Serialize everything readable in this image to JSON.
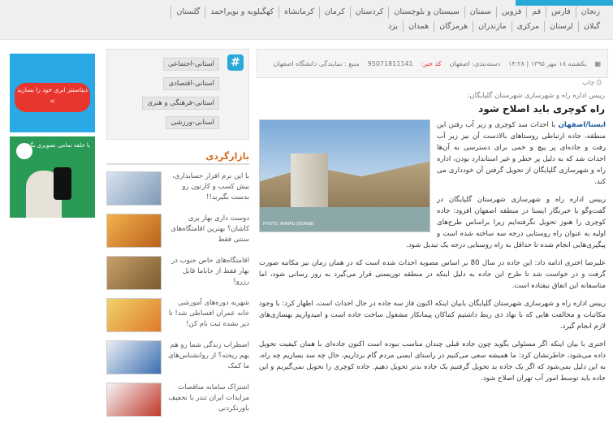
{
  "topbar": {
    "provinces": [
      "زنجان",
      "فارس",
      "قم",
      "قزوین",
      "سمنان",
      "سیستان و بلوچستان",
      "کردستان",
      "کرمان",
      "کرمانشاه",
      "کهگیلویه و بویراحمد",
      "گلستان",
      "گیلان",
      "لرستان",
      "مرکزی",
      "مازندران",
      "هرمزگان",
      "همدان",
      "یزد"
    ]
  },
  "article": {
    "meta": {
      "date": "یکشنبه ۱۸ مهر ۱۳۹۵ | ۱۴:۲۸",
      "category": "دسته‌بندی: اصفهان",
      "code_label": "کد خبر:",
      "code_value": "95071811141",
      "source": "منبع : نمایندگی دانشگاه اصفهان",
      "print": "چاپ"
    },
    "lead": "رییس اداره راه و شهرسازی شهرستان گلپایگان:",
    "title": "راه کوچری باید اصلاح شود",
    "brand": "ایسنا/اصفهان",
    "p1": "با احداث سد کوچری و زیر آب رفتن این منطقه، جاده ارتباطی روستاهای بالادست آن نیز زیر آب رفت و جاده‌ای پر پیچ و خمی برای دسترسی به آن‌ها احداث شد که به دلیل پر خطر و غیر استاندارد بودن، اداره راه و شهرسازی گلپایگان از تحویل گرفتن آن خودداری می کند.",
    "p2": "رییس اداره راه و شهرسازی شهرستان گلپایگان در گفت‌وگو با خبرنگار ایسنا در منطقه اصفهان افزود: جاده کوچری را هنوز تحویل نگرفته‌ایم زیرا براساس طرح‌های اولیه به عنوان راه روستایی درجه سه ساخته شده است و پیگیری‌هایی انجام شده تا حداقل به راه روستایی درجه یک تبدیل شود.",
    "p3": "علیرضا اختری ادامه داد: این جاده در سال 80 بر اساس مصوبه احداث شده است که در همان زمان نیز مکاتبه صورت گرفت و در خواست شد تا طرح این جاده به دلیل اینکه در منطقه توریستی قرار می‌گیرد به روز رسانی شود، اما متاسفانه این اتفاق نیفتاده است.",
    "p4": "رییس اداره راه و شهرسازی شهرستان گلپایگان بابیان اینکه اکنون فاز سه جاده در حال احداث است، اظهار کرد: با وجود مکاتبات و مخالفت هایی که با نهاد ذی ربط داشتیم کماکان پیمانکار مشغول ساخت جاده است و امیدواریم بهسازی‌های لازم انجام گیرد.",
    "p5": "اختری با بیان اینکه اگر مسئولی بگوید چون جاده قبلی چندان مناسب نبوده است اکنون جاده‌ای با همان کیفیت تحویل داده می‌شود، خاطرنشان کرد: ما همیشه سعی می‌کنیم در راستای ایمنی مردم گام برداریم، حال چه سد بسازیم چه راه، به این دلیل نمی‌شود که اگر یک جاده بد تحویل گرفتیم یک جاده بدتر تحویل دهیم. جاده کوچری را تحویل نمی‌گیریم و این جاده باید توسط امور آب تهران اصلاح شود.",
    "photo_caption": "PHOTO: AHMAD JOORABI"
  },
  "tags": [
    "استانی-اجتماعی",
    "استانی-اقتصادی",
    "استانی-فرهنگی و هنری",
    "استانی-ورزشی"
  ],
  "market": {
    "heading": "بازارگردی",
    "items": [
      {
        "text": "با این نرم افزار حسابداری، بیش کسب و کارتون رو بدست بگیرید!!"
      },
      {
        "text": "دوست داری بهار بری کاشان؟ بهترین اقامتگاه‌های سنتی فقط"
      },
      {
        "text": "اقامتگاه‌های خاص جنوب در بهار فقط از جاباما قابل رزرو!"
      },
      {
        "text": "شهریه دوره‌های آموزشی خانه عمران اقساطی شد! تا دیر نشده ثبت نام کن!"
      },
      {
        "text": "اضطراب زندگی شما رو هم بهم ریخته؟ از روانشناس‌های ما کمک"
      },
      {
        "text": "اشتراک سامانه مناقصات مزایدات ایران تندر با تخفیف باورنکردنی"
      }
    ]
  },
  "ads": {
    "ad1_text": "دیتاسنتر ابری خود را بسازید >",
    "ad2_text": "با حلقه تمامی تصویری بگیر!"
  }
}
